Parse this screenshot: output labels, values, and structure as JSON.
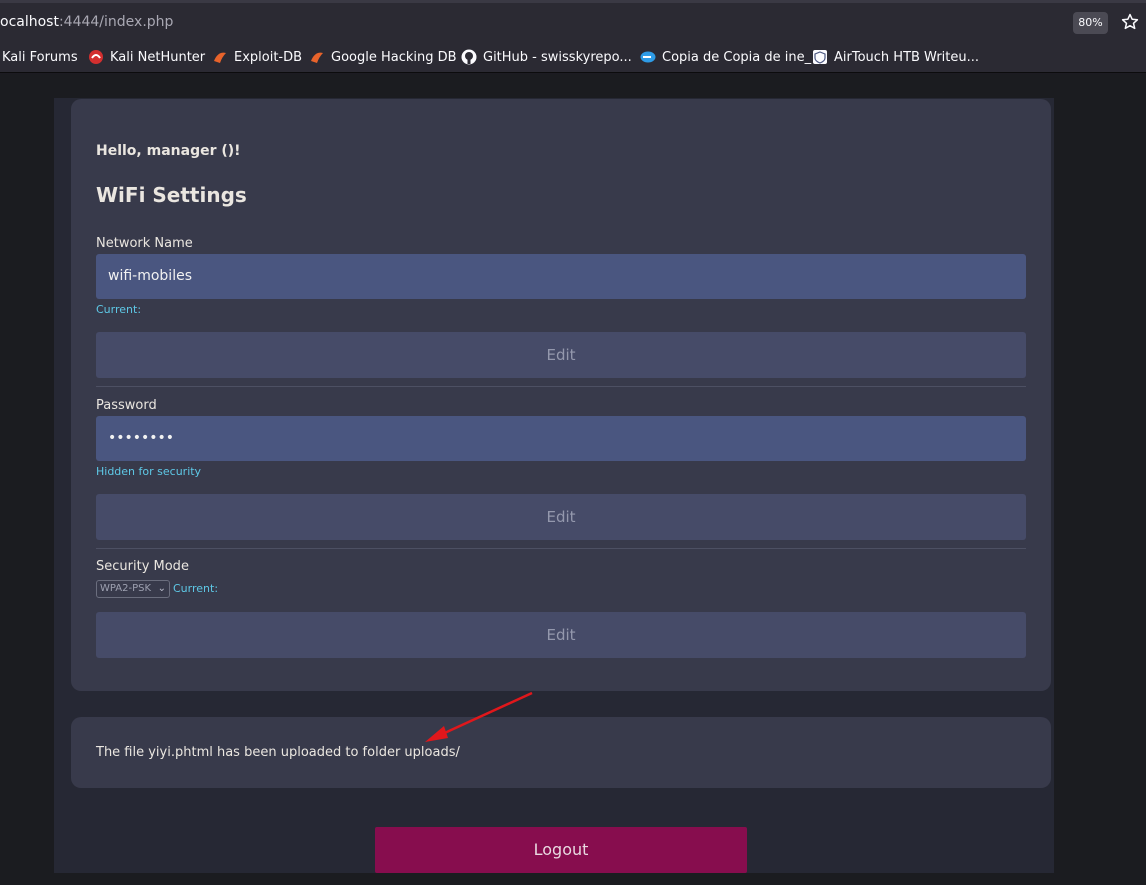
{
  "browser": {
    "url_host": "ocalhost",
    "url_rest": ":4444/index.php",
    "zoom": "80%",
    "bookmarks": [
      {
        "label": "Kali Forums",
        "icon": "kali-forums-icon"
      },
      {
        "label": "Kali NetHunter",
        "icon": "nethunter-icon"
      },
      {
        "label": "Exploit-DB",
        "icon": "exploitdb-icon"
      },
      {
        "label": "Google Hacking DB",
        "icon": "ghdb-icon"
      },
      {
        "label": "GitHub - swisskyrepo...",
        "icon": "github-icon"
      },
      {
        "label": "Copia de Copia de ine_",
        "icon": "copia-icon"
      },
      {
        "label": "AirTouch HTB Writeu...",
        "icon": "airtouch-icon"
      }
    ]
  },
  "card": {
    "greeting": "Hello, manager ()!",
    "title": "WiFi Settings",
    "network": {
      "label": "Network Name",
      "value": "wifi-mobiles",
      "hint": "Current:",
      "edit": "Edit"
    },
    "password": {
      "label": "Password",
      "value": "••••••••",
      "hint": "Hidden for security",
      "edit": "Edit"
    },
    "security": {
      "label": "Security Mode",
      "selected": "WPA2-PSK",
      "hint": "Current:",
      "edit": "Edit"
    }
  },
  "message": {
    "text": "The file yiyi.phtml has been uploaded to folder uploads/"
  },
  "logout_label": "Logout",
  "colors": {
    "accent_field": "#4a5680",
    "logout": "#870d4e",
    "hint": "#5ec8e6",
    "arrow": "#e0171b"
  }
}
